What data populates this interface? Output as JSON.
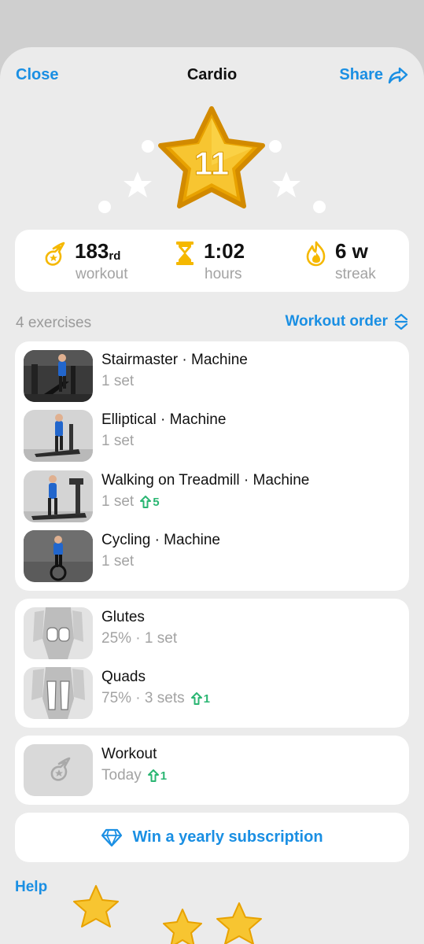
{
  "header": {
    "close_label": "Close",
    "title": "Cardio",
    "share_label": "Share"
  },
  "hero": {
    "level": "11"
  },
  "stats": {
    "workout_value": "183",
    "workout_suffix": "rd",
    "workout_label": "workout",
    "hours_value": "1:02",
    "hours_label": "hours",
    "streak_value": "6 w",
    "streak_label": "streak"
  },
  "exercises_section": {
    "count_label": "4 exercises",
    "order_label": "Workout order"
  },
  "exercises": [
    {
      "title": "Stairmaster · Machine",
      "sub": "1 set",
      "delta": ""
    },
    {
      "title": "Elliptical · Machine",
      "sub": "1 set",
      "delta": ""
    },
    {
      "title": "Walking on Treadmill · Machine",
      "sub": "1 set",
      "delta": "5"
    },
    {
      "title": "Cycling · Machine",
      "sub": "1 set",
      "delta": ""
    }
  ],
  "muscles": [
    {
      "title": "Glutes",
      "sub": "25% · 1 set",
      "delta": ""
    },
    {
      "title": "Quads",
      "sub": "75% · 3 sets",
      "delta": "1"
    }
  ],
  "workout_item": {
    "title": "Workout",
    "sub": "Today",
    "delta": "1"
  },
  "promo": {
    "label": "Win a yearly subscription"
  },
  "footer": {
    "help_label": "Help"
  },
  "colors": {
    "accent": "#1a8fe3",
    "gold": "#f5b800",
    "positive": "#2bb673",
    "background": "#ebebeb"
  },
  "icons": [
    "share-arrow-icon",
    "star-badge-icon",
    "meteor-icon",
    "hourglass-icon",
    "flame-icon",
    "sort-arrows-icon",
    "up-arrow-icon",
    "diamond-icon"
  ]
}
